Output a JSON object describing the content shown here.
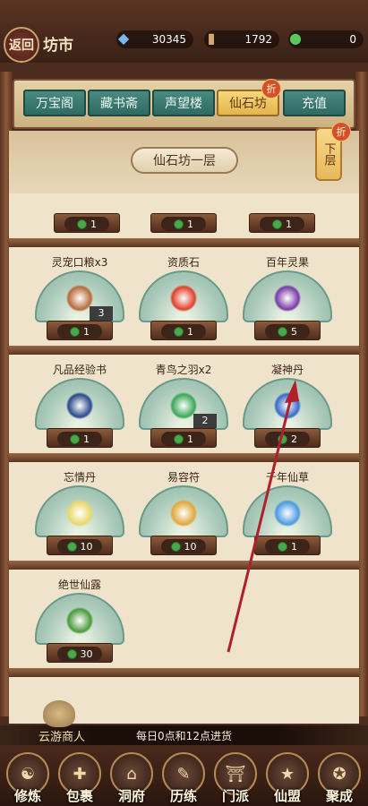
{
  "header": {
    "back_label": "返回",
    "title": "坊市",
    "resources": [
      {
        "icon": "crystal-icon",
        "value": "30345"
      },
      {
        "icon": "scroll-icon",
        "value": "1792"
      },
      {
        "icon": "jade-coin-icon",
        "value": "0"
      }
    ]
  },
  "tabs": [
    {
      "label": "万宝阁",
      "active": false
    },
    {
      "label": "藏书斋",
      "active": false
    },
    {
      "label": "声望楼",
      "active": false
    },
    {
      "label": "仙石坊",
      "active": true,
      "badge": "折"
    },
    {
      "label": "充值",
      "active": false
    }
  ],
  "floor": {
    "current": "仙石坊一层",
    "next": "下层",
    "next_badge": "折"
  },
  "partial_row": [
    {
      "price": "1"
    },
    {
      "price": "1"
    },
    {
      "price": "1"
    }
  ],
  "items": [
    {
      "name": "灵宠口粮x3",
      "price": "1",
      "qty": "3",
      "icon": "food-icon",
      "color": "#b86a3a"
    },
    {
      "name": "资质石",
      "price": "1",
      "qty": "",
      "icon": "red-gem-icon",
      "color": "#e0402a"
    },
    {
      "name": "百年灵果",
      "price": "5",
      "qty": "",
      "icon": "grape-icon",
      "color": "#7a3aa8"
    },
    {
      "name": "凡品经验书",
      "price": "1",
      "qty": "",
      "icon": "book-icon",
      "color": "#2a4a8a"
    },
    {
      "name": "青鸟之羽x2",
      "price": "1",
      "qty": "2",
      "icon": "feather-icon",
      "color": "#3aa85a"
    },
    {
      "name": "凝神丹",
      "price": "2",
      "qty": "",
      "icon": "pill-icon",
      "color": "#3a6ac8"
    },
    {
      "name": "忘情丹",
      "price": "10",
      "qty": "",
      "icon": "glow-pill-icon",
      "color": "#e8d86a"
    },
    {
      "name": "易容符",
      "price": "10",
      "qty": "",
      "icon": "talisman-icon",
      "color": "#e0a83a"
    },
    {
      "name": "千年仙草",
      "price": "1",
      "qty": "",
      "icon": "herb-icon",
      "color": "#4a9ae0"
    },
    {
      "name": "绝世仙露",
      "price": "30",
      "qty": "",
      "icon": "dew-icon",
      "color": "#4a9a3a"
    }
  ],
  "notice": "每日0点和12点进货",
  "merchant_label": "云游商人",
  "nav": [
    {
      "label": "修炼",
      "icon": "cultivate-icon"
    },
    {
      "label": "包裹",
      "icon": "bag-icon"
    },
    {
      "label": "洞府",
      "icon": "cave-icon"
    },
    {
      "label": "历练",
      "icon": "scroll-map-icon"
    },
    {
      "label": "门派",
      "icon": "gate-icon"
    },
    {
      "label": "仙盟",
      "icon": "alliance-icon"
    },
    {
      "label": "聚成",
      "icon": "array-icon"
    }
  ]
}
